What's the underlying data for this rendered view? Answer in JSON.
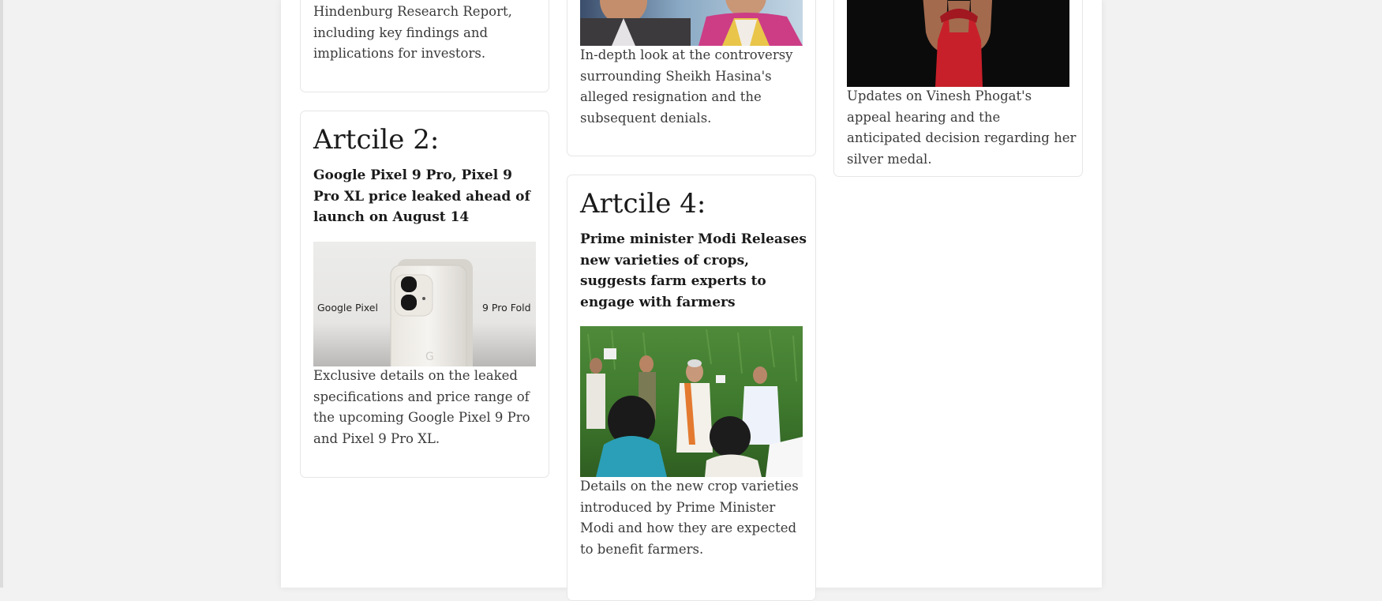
{
  "articles": {
    "a1": {
      "summary_partial": "Hindenburg Research Report, including key findings and implications for investors."
    },
    "a2": {
      "heading": "Artcile 2:",
      "headline": "Google Pixel 9 Pro, Pixel 9 Pro XL price leaked ahead of launch on August 14",
      "image_label_left": "Google Pixel",
      "image_label_right": "9 Pro Fold",
      "summary": "Exclusive details on the leaked specifications and price range of the upcoming Google Pixel 9 Pro and Pixel 9 Pro XL."
    },
    "a3": {
      "summary": "In-depth look at the controversy surrounding Sheikh Hasina's alleged resignation and the subsequent denials."
    },
    "a4": {
      "heading": "Artcile 4:",
      "headline": "Prime minister Modi Releases new varieties of crops, suggests farm experts to engage with farmers",
      "summary": "Details on the new crop varieties introduced by Prime Minister Modi and how they are expected to benefit farmers."
    },
    "a5": {
      "summary": "Updates on Vinesh Phogat's appeal hearing and the anticipated decision regarding her silver medal."
    }
  }
}
